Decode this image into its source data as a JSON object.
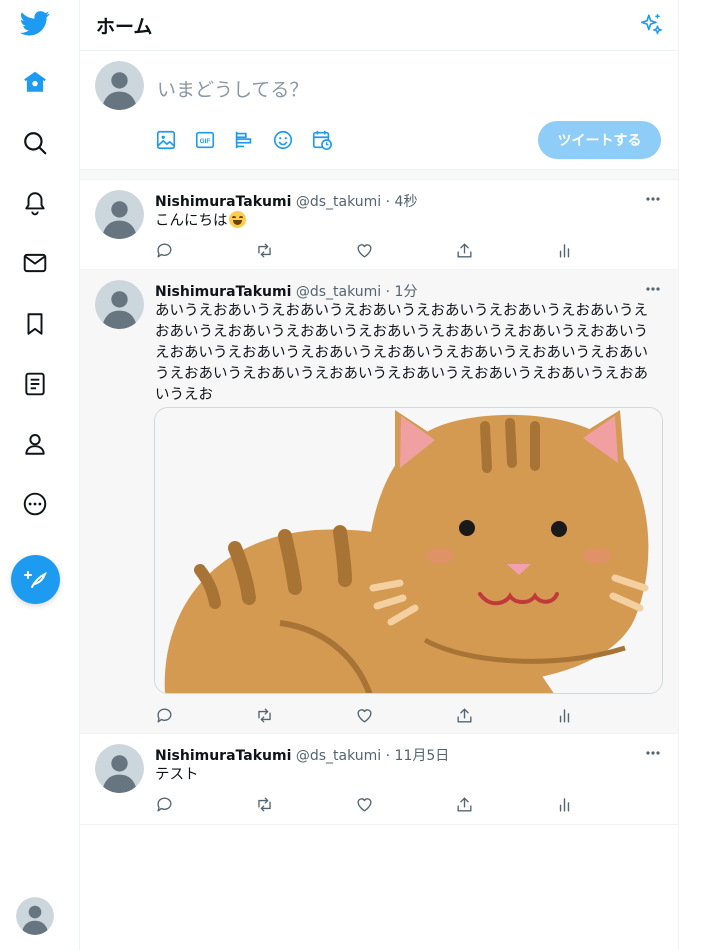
{
  "header": {
    "title": "ホーム",
    "sparkle_icon": "sparkle-icon"
  },
  "nav": {
    "items": [
      {
        "name": "twitter-logo-icon"
      },
      {
        "name": "home-icon"
      },
      {
        "name": "search-icon"
      },
      {
        "name": "bell-icon"
      },
      {
        "name": "mail-icon"
      },
      {
        "name": "bookmark-icon"
      },
      {
        "name": "list-icon"
      },
      {
        "name": "profile-icon"
      },
      {
        "name": "more-circle-icon"
      }
    ],
    "compose_icon": "feather-plus-icon"
  },
  "composer": {
    "placeholder": "いまどうしてる？",
    "tweet_button": "ツイートする",
    "icons": [
      "image-icon",
      "gif-icon",
      "poll-icon",
      "emoji-icon",
      "schedule-icon"
    ]
  },
  "tweets": [
    {
      "name": "NishimuraTakumi",
      "handle": "@ds_takumi",
      "sep": "·",
      "time": "4秒",
      "text": "こんにちは"
    },
    {
      "name": "NishimuraTakumi",
      "handle": "@ds_takumi",
      "sep": "·",
      "time": "1分",
      "text": "あいうえおあいうえおあいうえおあいうえおあいうえおあいうえおあいうえおあいうえおあいうえおあいうえおあいうえおあいうえおあいうえおあいうえおあいうえおあいうえおあいうえおあいうえおあいうえおあいうえおあいうえおあいうえおあいうえおあいうえおあいうえおあいうえおあいうえおあいうえお"
    },
    {
      "name": "NishimuraTakumi",
      "handle": "@ds_takumi",
      "sep": "·",
      "time": "11月5日",
      "text": "テスト"
    }
  ],
  "colors": {
    "accent": "#1d9bf0",
    "button_disabled": "#8ecdf8",
    "muted": "#536471"
  }
}
